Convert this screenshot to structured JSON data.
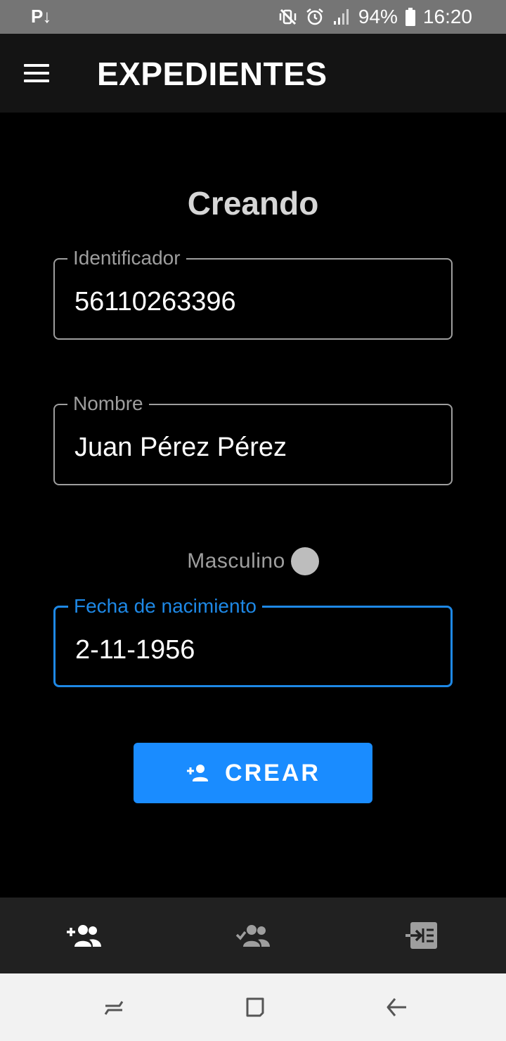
{
  "status_bar": {
    "left_icon": "P↓",
    "battery": "94%",
    "time": "16:20",
    "icons": [
      "mute-vibrate-icon",
      "alarm-icon",
      "signal-icon",
      "battery-icon"
    ]
  },
  "app_bar": {
    "title": "EXPEDIENTES",
    "menu_icon": "hamburger-menu-icon"
  },
  "form": {
    "heading": "Creando",
    "identificador": {
      "label": "Identificador",
      "value": "56110263396"
    },
    "nombre": {
      "label": "Nombre",
      "value": "Juan Pérez Pérez"
    },
    "gender": {
      "label": "Masculino",
      "checked": true
    },
    "fecha": {
      "label": "Fecha de nacimiento",
      "value": "2-11-1956",
      "focused": true
    },
    "submit_label": "CREAR",
    "submit_icon": "person-add-icon"
  },
  "bottom_nav": {
    "items": [
      {
        "icon": "group-add-icon",
        "active": true
      },
      {
        "icon": "group-check-icon",
        "active": false
      },
      {
        "icon": "login-list-icon",
        "active": false
      }
    ]
  },
  "system_nav": {
    "items": [
      "recents-icon",
      "home-icon",
      "back-icon"
    ]
  },
  "colors": {
    "accent": "#1a8cff",
    "focus_border": "#1e88e5",
    "app_bar": "#141414",
    "bottom_nav": "#212121",
    "status_bar": "#757575"
  }
}
